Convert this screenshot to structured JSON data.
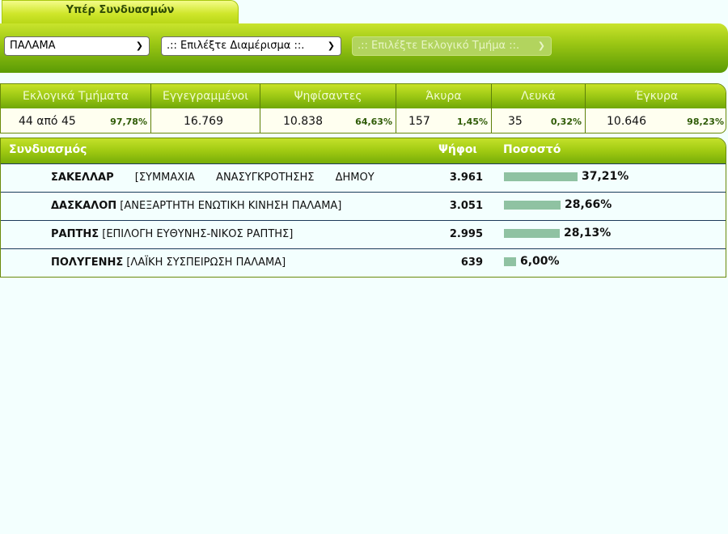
{
  "tab": {
    "label": "Υπέρ Συνδυασμών"
  },
  "selects": {
    "municipality": "ΠΑΛΑΜΑ",
    "district": ".:: Επιλέξτε Διαμέρισμα ::.",
    "section": ".:: Επιλέξτε Εκλογικό Τμήμα ::."
  },
  "stats": {
    "headers": [
      "Εκλογικά Τμήματα",
      "Εγγεγραμμένοι",
      "Ψηφίσαντες",
      "Άκυρα",
      "Λευκά",
      "Έγκυρα"
    ],
    "sections": {
      "value": "44 από 45",
      "pct": "97,78%"
    },
    "registered": {
      "value": "16.769"
    },
    "voted": {
      "value": "10.838",
      "pct": "64,63%"
    },
    "invalid": {
      "value": "157",
      "pct": "1,45%"
    },
    "blank": {
      "value": "35",
      "pct": "0,32%"
    },
    "valid": {
      "value": "10.646",
      "pct": "98,23%"
    }
  },
  "results": {
    "headers": {
      "party": "Συνδυασμός",
      "votes": "Ψήφοι",
      "percent": "Ποσοστό"
    },
    "rows": [
      {
        "leader": "ΣΑΚΕΛΛΑΡ",
        "party": "[ΣΥΜΜΑΧΙΑ ΑΝΑΣΥΓΚΡΟΤΗΣΗΣ ΔΗΜΟΥ",
        "votes": "3.961",
        "pct": "37,21%",
        "share": 37.21
      },
      {
        "leader": "ΔΑΣΚΑΛΟΠ",
        "party": "[ΑΝΕΞΑΡΤΗΤΗ ΕΝΩΤΙΚΗ ΚΙΝΗΣΗ ΠΑΛΑΜΑ]",
        "votes": "3.051",
        "pct": "28,66%",
        "share": 28.66
      },
      {
        "leader": "ΡΑΠΤΗΣ",
        "party": "[ΕΠΙΛΟΓΗ ΕΥΘΥΝΗΣ-ΝΙΚΟΣ ΡΑΠΤΗΣ]",
        "votes": "2.995",
        "pct": "28,13%",
        "share": 28.13
      },
      {
        "leader": "ΠΟΛΥΓΕΝΗΣ",
        "party": "[ΛΑΪΚΗ ΣΥΣΠΕΙΡΩΣΗ ΠΑΛΑΜΑ]",
        "votes": "639",
        "pct": "6,00%",
        "share": 6.0
      }
    ]
  },
  "colors": {
    "bar": "#8fc2a2",
    "header_green": "#9cc814",
    "background": "#f3fffe"
  }
}
